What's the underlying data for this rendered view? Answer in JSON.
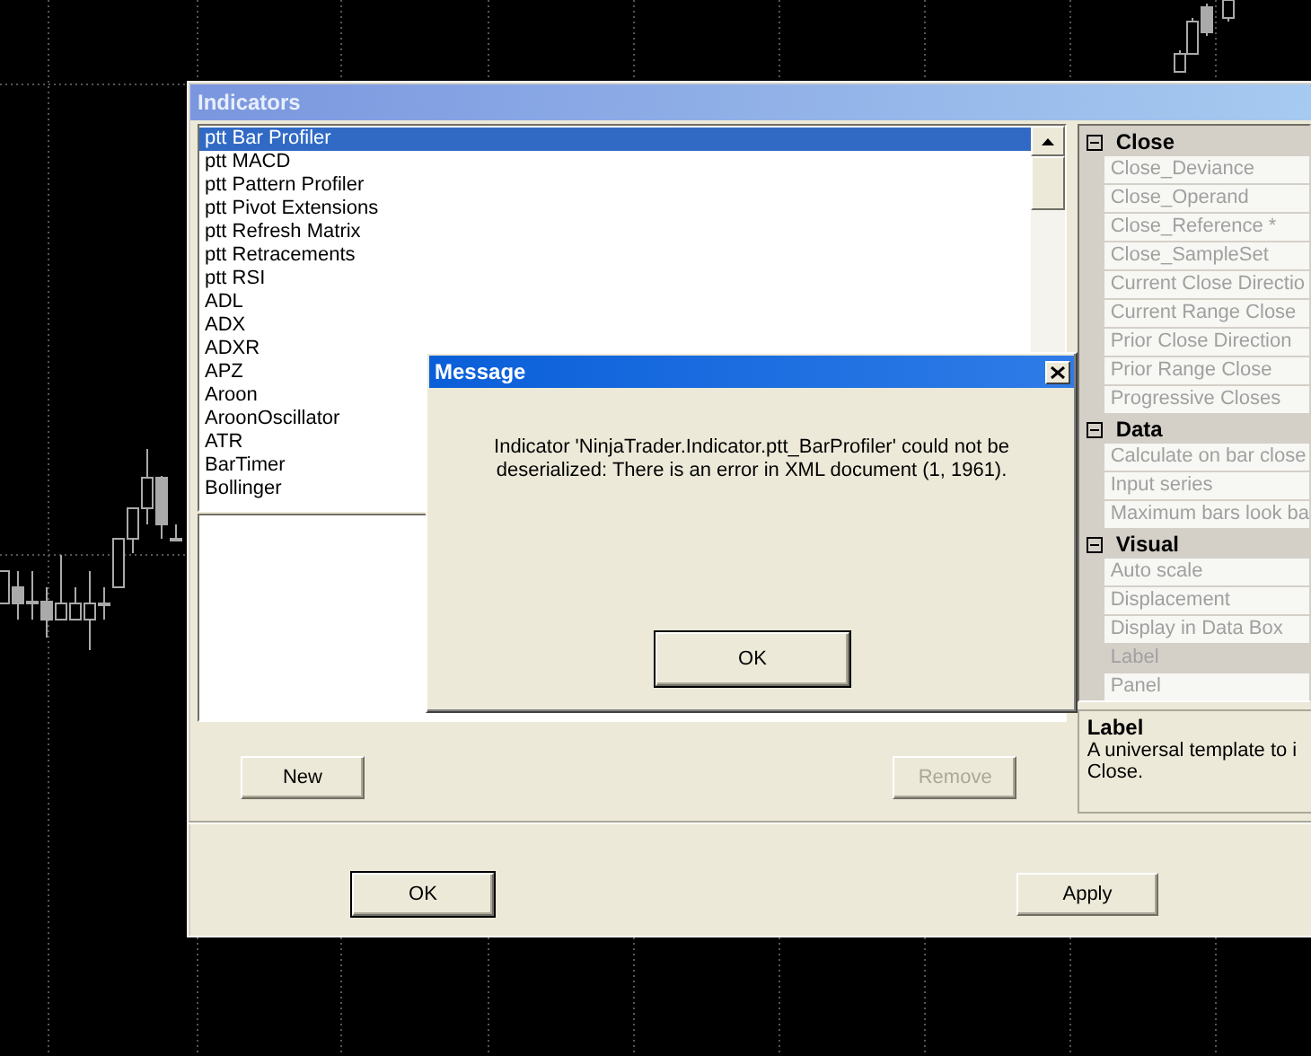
{
  "indicators_window": {
    "title": "Indicators",
    "list": [
      {
        "label": "ptt Bar Profiler",
        "selected": true
      },
      {
        "label": "ptt MACD",
        "selected": false
      },
      {
        "label": "ptt Pattern Profiler",
        "selected": false
      },
      {
        "label": "ptt Pivot Extensions",
        "selected": false
      },
      {
        "label": "ptt Refresh Matrix",
        "selected": false
      },
      {
        "label": "ptt Retracements",
        "selected": false
      },
      {
        "label": "ptt RSI",
        "selected": false
      },
      {
        "label": "ADL",
        "selected": false
      },
      {
        "label": "ADX",
        "selected": false
      },
      {
        "label": "ADXR",
        "selected": false
      },
      {
        "label": "APZ",
        "selected": false
      },
      {
        "label": "Aroon",
        "selected": false
      },
      {
        "label": "AroonOscillator",
        "selected": false
      },
      {
        "label": "ATR",
        "selected": false
      },
      {
        "label": "BarTimer",
        "selected": false
      },
      {
        "label": "Bollinger",
        "selected": false
      }
    ],
    "buttons": [
      {
        "label": "New",
        "disabled": false
      },
      {
        "label": "Remove",
        "disabled": true
      }
    ],
    "properties": [
      {
        "name": "Close",
        "expanded": true,
        "items": [
          {
            "label": "Close_Deviance",
            "disabled": true,
            "selected": false
          },
          {
            "label": "Close_Operand",
            "disabled": true,
            "selected": false
          },
          {
            "label": "Close_Reference *",
            "disabled": true,
            "selected": false
          },
          {
            "label": "Close_SampleSet",
            "disabled": true,
            "selected": false
          },
          {
            "label": "Current Close Directio",
            "disabled": true,
            "selected": false
          },
          {
            "label": "Current Range Close",
            "disabled": true,
            "selected": false
          },
          {
            "label": "Prior Close Direction",
            "disabled": true,
            "selected": false
          },
          {
            "label": "Prior Range Close",
            "disabled": true,
            "selected": false
          },
          {
            "label": "Progressive Closes",
            "disabled": true,
            "selected": false
          }
        ]
      },
      {
        "name": "Data",
        "expanded": true,
        "items": [
          {
            "label": "Calculate on bar close",
            "disabled": true,
            "selected": false
          },
          {
            "label": "Input series",
            "disabled": true,
            "selected": false
          },
          {
            "label": "Maximum bars look ba",
            "disabled": true,
            "selected": false
          }
        ]
      },
      {
        "name": "Visual",
        "expanded": true,
        "items": [
          {
            "label": "Auto scale",
            "disabled": true,
            "selected": false
          },
          {
            "label": "Displacement",
            "disabled": true,
            "selected": false
          },
          {
            "label": "Display in Data Box",
            "disabled": true,
            "selected": false
          },
          {
            "label": "Label",
            "disabled": true,
            "selected": true
          },
          {
            "label": "Panel",
            "disabled": true,
            "selected": false
          }
        ]
      }
    ],
    "description": {
      "title": "Label",
      "lines": [
        "A universal template to i",
        "Close."
      ]
    },
    "footer_buttons": [
      {
        "label": "OK",
        "default": true
      },
      {
        "label": "Apply",
        "default": false
      }
    ]
  },
  "message_dialog": {
    "title": "Message",
    "lines": [
      "Indicator 'NinjaTrader.Indicator.ptt_BarProfiler' could not be",
      "deserialized: There is an error in XML document (1, 1961)."
    ],
    "button": {
      "label": "OK",
      "default": true
    }
  }
}
